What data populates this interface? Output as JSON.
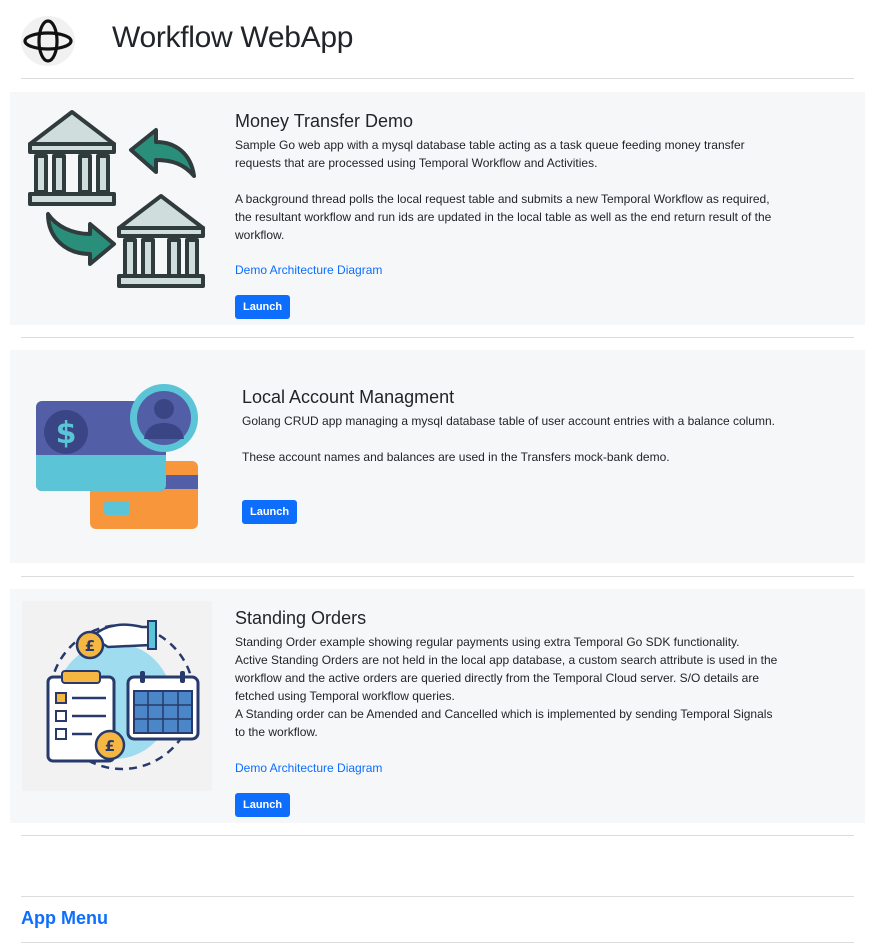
{
  "header": {
    "title": "Workflow WebApp",
    "logo_icon": "temporal-logo-icon"
  },
  "cards": [
    {
      "title": "Money Transfer Demo",
      "paragraphs": [
        "Sample Go web app with a mysql database table acting as a task queue feeding money transfer requests that are processed using Temporal Workflow and Activities.",
        "A background thread polls the local request table and submits a new Temporal Workflow as required, the resultant workflow and run ids are updated in the local table as well as the end return result of the workflow."
      ],
      "link": "Demo Architecture Diagram",
      "button": "Launch",
      "image_icon": "bank-transfer-icon"
    },
    {
      "title": "Local Account Managment",
      "paragraphs": [
        "Golang CRUD app managing a mysql database table of user account entries with a balance column.",
        "These account names and balances are used in the Transfers mock-bank demo."
      ],
      "button": "Launch",
      "image_icon": "account-cards-icon"
    },
    {
      "title": "Standing Orders",
      "paragraphs": [
        "Standing Order example showing regular payments using extra Temporal Go SDK functionality.",
        "Active Standing Orders are not held in the local app database, a custom search attribute is used in the workflow and the active orders are queried directly from the Temporal Cloud server. S/O details are fetched using Temporal workflow queries.",
        "A Standing order can be Amended and Cancelled which is implemented by sending Temporal Signals to the workflow."
      ],
      "link": "Demo Architecture Diagram",
      "button": "Launch",
      "image_icon": "standing-order-icon"
    }
  ],
  "footer": {
    "menu_link": "App Menu"
  },
  "colors": {
    "link": "#0d6efd",
    "card_bg": "#f6f7f9",
    "teal": "#2a8f7a",
    "bank": "#cfdedc"
  }
}
